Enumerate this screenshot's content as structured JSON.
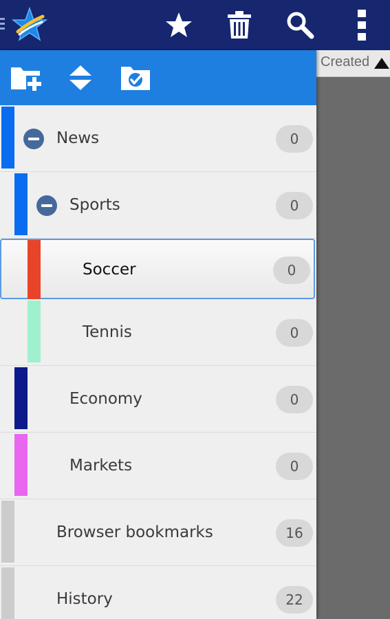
{
  "topbar": {
    "background": "#16266f",
    "icons": [
      "drawer-handle-icon",
      "app-star-logo-icon",
      "star-icon",
      "trash-icon",
      "search-icon",
      "overflow-menu-icon"
    ]
  },
  "drawer_toolbar": {
    "background": "#1e7fe0",
    "icons": [
      "add-folder-icon",
      "expand-collapse-icon",
      "folder-check-icon"
    ]
  },
  "folders": [
    {
      "label": "News",
      "count": "0",
      "color": "#0a6df0",
      "collapsible": true
    },
    {
      "label": "Sports",
      "count": "0",
      "color": "#0a6df0",
      "collapsible": true
    },
    {
      "label": "Soccer",
      "count": "0",
      "color": "#e8442a",
      "selected": true
    },
    {
      "label": "Tennis",
      "count": "0",
      "color": "#9ff0cf"
    },
    {
      "label": "Economy",
      "count": "0",
      "color": "#0c1a8a"
    },
    {
      "label": "Markets",
      "count": "0",
      "color": "#e866f0"
    },
    {
      "label": "Browser bookmarks",
      "count": "16",
      "color": "#cccccc"
    },
    {
      "label": "History",
      "count": "22",
      "color": "#cccccc"
    }
  ],
  "right_pane": {
    "sort_label": "Created"
  }
}
